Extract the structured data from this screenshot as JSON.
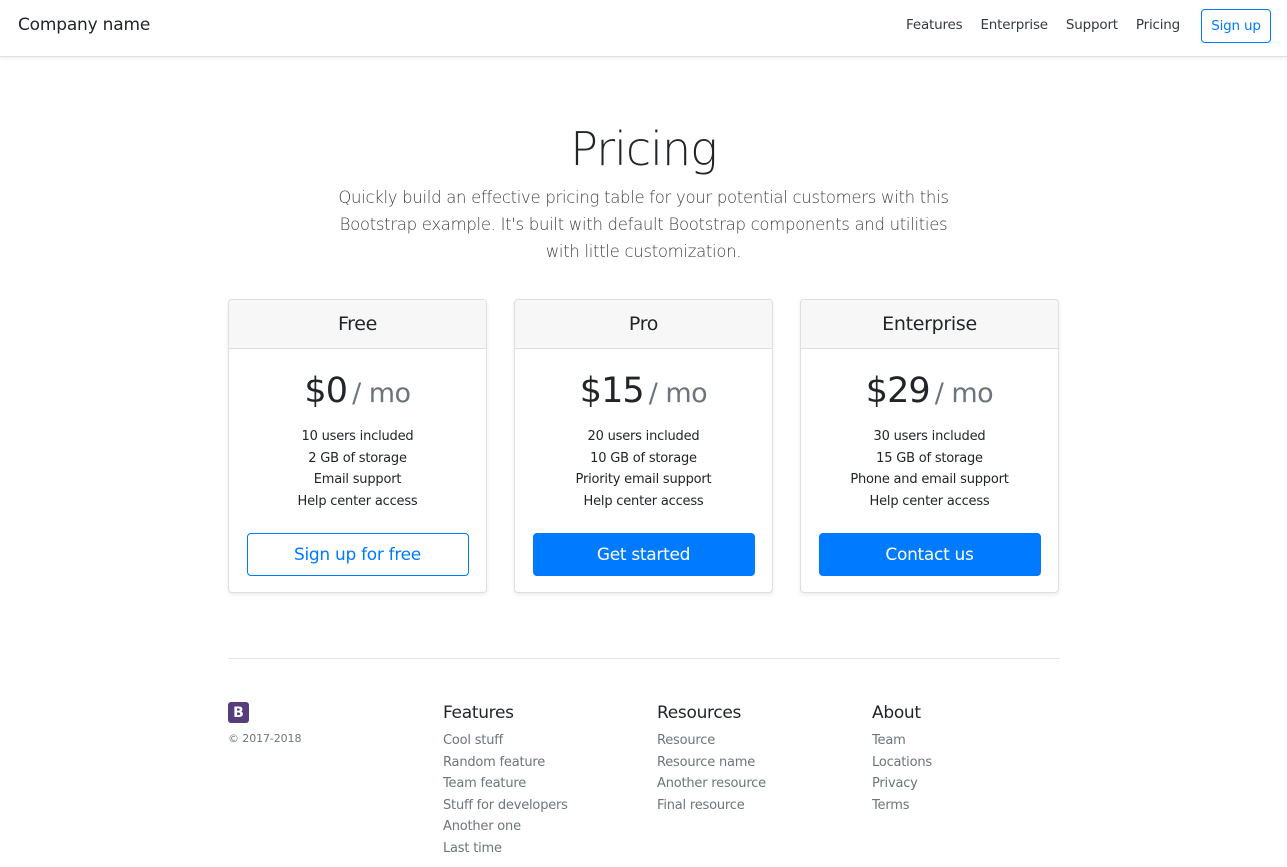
{
  "navbar": {
    "brand": "Company name",
    "links": [
      "Features",
      "Enterprise",
      "Support",
      "Pricing"
    ],
    "signup_label": "Sign up"
  },
  "hero": {
    "title": "Pricing",
    "lead": "Quickly build an effective pricing table for your potential customers with this Bootstrap example. It's built with default Bootstrap components and utilities with little customization."
  },
  "plans": [
    {
      "name": "Free",
      "price": "$0",
      "unit": "/ mo",
      "features": [
        "10 users included",
        "2 GB of storage",
        "Email support",
        "Help center access"
      ],
      "button_label": "Sign up for free",
      "button_style": "outline"
    },
    {
      "name": "Pro",
      "price": "$15",
      "unit": "/ mo",
      "features": [
        "20 users included",
        "10 GB of storage",
        "Priority email support",
        "Help center access"
      ],
      "button_label": "Get started",
      "button_style": "primary"
    },
    {
      "name": "Enterprise",
      "price": "$29",
      "unit": "/ mo",
      "features": [
        "30 users included",
        "15 GB of storage",
        "Phone and email support",
        "Help center access"
      ],
      "button_label": "Contact us",
      "button_style": "primary"
    }
  ],
  "footer": {
    "logo_letter": "B",
    "logo_icon": "bootstrap-logo-icon",
    "copyright": "© 2017-2018",
    "columns": [
      {
        "title": "Features",
        "links": [
          "Cool stuff",
          "Random feature",
          "Team feature",
          "Stuff for developers",
          "Another one",
          "Last time"
        ]
      },
      {
        "title": "Resources",
        "links": [
          "Resource",
          "Resource name",
          "Another resource",
          "Final resource"
        ]
      },
      {
        "title": "About",
        "links": [
          "Team",
          "Locations",
          "Privacy",
          "Terms"
        ]
      }
    ]
  },
  "colors": {
    "primary": "#007bff",
    "brand_purple": "#563d7c",
    "muted": "#6c757d",
    "card_header_bg": "#f7f7f7"
  }
}
